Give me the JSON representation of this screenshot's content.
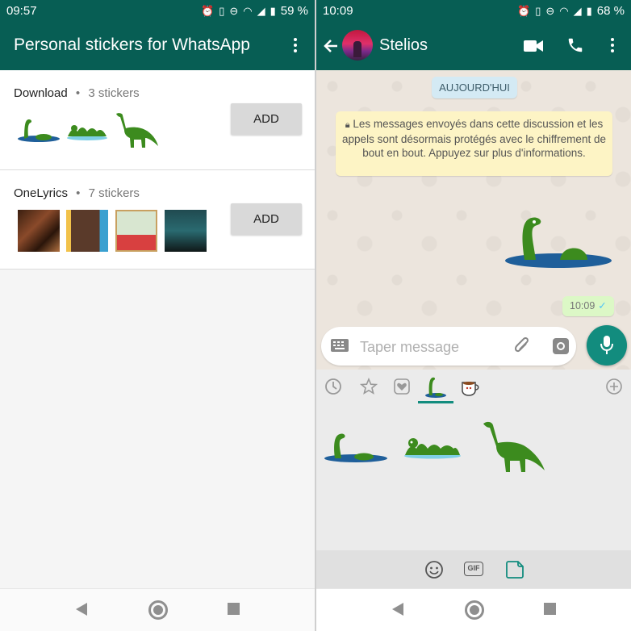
{
  "left": {
    "status": {
      "time": "09:57",
      "battery": "59 %"
    },
    "app_title": "Personal stickers for WhatsApp",
    "packs": [
      {
        "name": "Download",
        "separator": "•",
        "count": "3 stickers",
        "add_label": "ADD"
      },
      {
        "name": "OneLyrics",
        "separator": "•",
        "count": "7 stickers",
        "add_label": "ADD"
      }
    ]
  },
  "right": {
    "status": {
      "time": "10:09",
      "battery": "68 %"
    },
    "contact_name": "Stelios",
    "date_label": "AUJOURD'HUI",
    "encryption_notice": "Les messages envoyés dans cette discussion et les appels sont désormais protégés avec le chiffrement de bout en bout. Appuyez sur plus d'informations.",
    "sent_time": "10:09",
    "input_placeholder": "Taper message",
    "gif_label": "GIF"
  },
  "colors": {
    "header": "#075e54",
    "accent": "#128c7e",
    "sticker_green": "#3c8b1e",
    "water": "#1f5f9a"
  },
  "icons": [
    "back-arrow-icon",
    "video-call-icon",
    "phone-icon",
    "more-vert-icon",
    "keyboard-icon",
    "attach-icon",
    "camera-icon",
    "mic-icon",
    "recent-icon",
    "star-icon",
    "heart-icon",
    "add-icon",
    "emoji-icon",
    "gif-icon",
    "sticker-icon"
  ]
}
